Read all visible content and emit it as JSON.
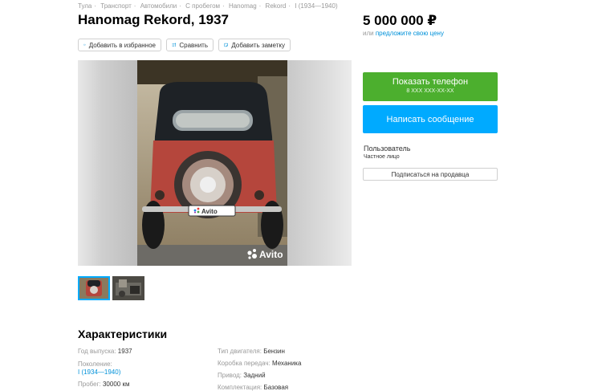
{
  "breadcrumb": [
    "Тула",
    "Транспорт",
    "Автомобили",
    "С пробегом",
    "Hanomag",
    "Rekord",
    "I (1934—1940)"
  ],
  "listing": {
    "title": "Hanomag Rekord, 1937",
    "price": "5 000 000 ₽",
    "price_or": "или",
    "price_offer": "предложите свою цену"
  },
  "actions": {
    "favorite": "Добавить в избранное",
    "compare": "Сравнить",
    "note": "Добавить заметку"
  },
  "gallery": {
    "watermark": "Avito",
    "plate": "Avito",
    "thumbnails": 2
  },
  "contact": {
    "phone_label": "Показать телефон",
    "phone_masked": "8 XXX XXX-XX-XX",
    "message_label": "Написать сообщение"
  },
  "seller": {
    "name": "Пользователь",
    "type": "Частное лицо",
    "subscribe": "Подписаться на продавца"
  },
  "characteristics": {
    "title": "Характеристики",
    "left": [
      {
        "label": "Год выпуска:",
        "value": "1937"
      },
      {
        "label": "Поколение:",
        "value": "I (1934—1940)"
      },
      {
        "label": "Пробег:",
        "value": "30000 км"
      }
    ],
    "right": [
      {
        "label": "Тип двигателя:",
        "value": "Бензин"
      },
      {
        "label": "Коробка передач:",
        "value": "Механика"
      },
      {
        "label": "Привод:",
        "value": "Задний"
      },
      {
        "label": "Комплектация:",
        "value": "Базовая"
      }
    ]
  },
  "colors": {
    "green": "#4caf2e",
    "blue": "#00aaff",
    "link": "#0091d9"
  }
}
